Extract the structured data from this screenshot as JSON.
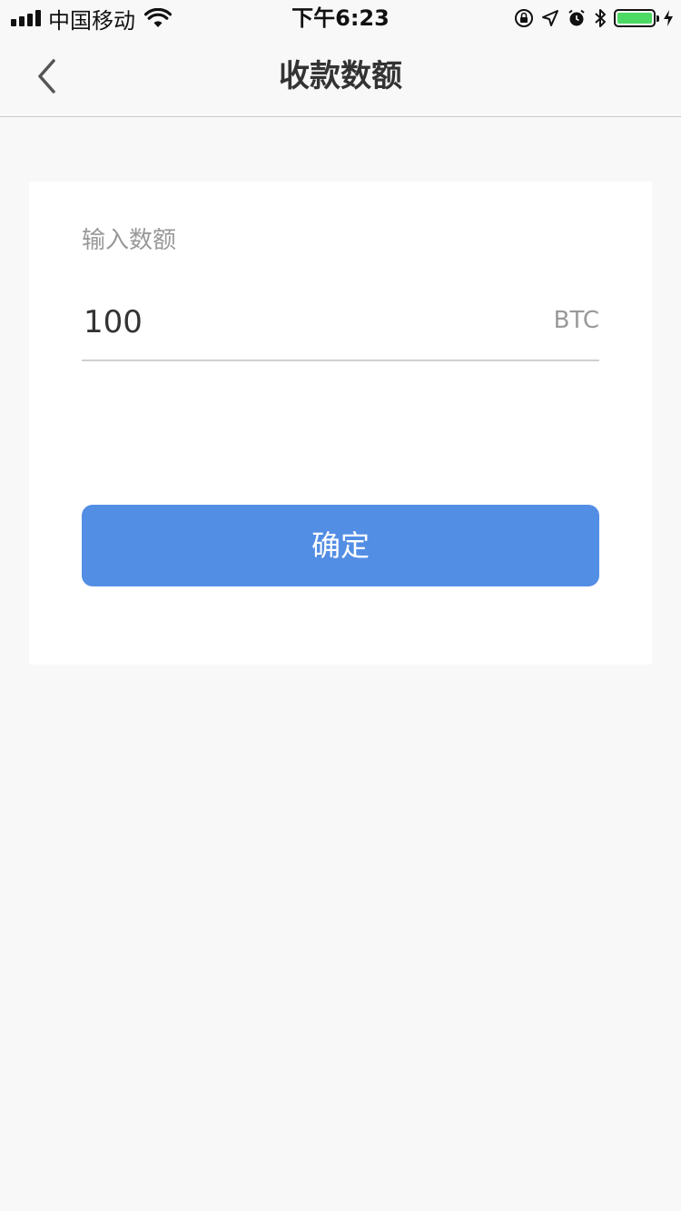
{
  "status_bar": {
    "carrier": "中国移动",
    "time": "下午6:23",
    "icons": [
      "signal-icon",
      "wifi-icon",
      "orientation-lock-icon",
      "location-arrow-icon",
      "alarm-icon",
      "bluetooth-icon",
      "battery-icon",
      "charging-bolt-icon"
    ],
    "battery_level": 1.0,
    "battery_color": "#4cd964"
  },
  "nav": {
    "title": "收款数额",
    "back_icon": "chevron-left-icon"
  },
  "form": {
    "label": "输入数额",
    "amount_value": "100",
    "unit": "BTC"
  },
  "actions": {
    "confirm_label": "确定"
  },
  "colors": {
    "accent": "#538ee5",
    "background": "#f8f8f8",
    "card": "#ffffff",
    "muted_text": "#999999"
  }
}
